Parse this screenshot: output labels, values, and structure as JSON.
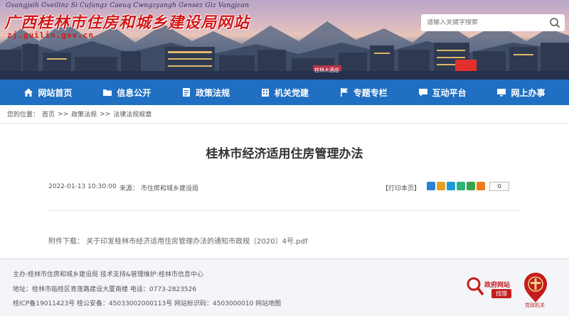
{
  "header": {
    "subtitle": "Gvangjsih Gveilinz Si Cufangz Caeuq Cwngzyangh Gensez Giz Vangjcan",
    "title": "广西桂林市住房和城乡建设局网站",
    "domain": "zj.guilin.gov.cn",
    "search_placeholder": "请输入关键字搜索",
    "hotel_sign": "桂林大酒店"
  },
  "nav": {
    "items": [
      {
        "label": "网站首页",
        "icon": "home-icon"
      },
      {
        "label": "信息公开",
        "icon": "folder-icon"
      },
      {
        "label": "政策法规",
        "icon": "document-icon"
      },
      {
        "label": "机关党建",
        "icon": "building-icon"
      },
      {
        "label": "专题专栏",
        "icon": "flag-icon"
      },
      {
        "label": "互动平台",
        "icon": "chat-icon"
      },
      {
        "label": "网上办事",
        "icon": "monitor-icon"
      }
    ]
  },
  "breadcrumb": {
    "prefix": "您的位置：",
    "items": [
      "首页",
      ">>",
      "政策法规",
      ">>",
      "法律法规规章"
    ]
  },
  "article": {
    "title": "桂林市经济适用住房管理办法",
    "date": "2022-01-13 10:30:00",
    "source_label": "来源：",
    "source": "市住房和城乡建设局",
    "print_label": "【打印本页】",
    "share_count": "0",
    "attachment_label": "附件下载：",
    "attachment_name": "关于印发桂林市经济适用住房管理办法的通知市政规〔2020〕4号.pdf"
  },
  "footer": {
    "line1": "主办:桂林市住房和城乡建设局 技术支持&管理维护:桂林市信息中心",
    "line2": "地址：桂林市临桂区青莲路建设大厦南楼 电话：0773-2823526",
    "line3": "桂ICP备19011423号  桂公安备：45033002000113号  网站标识码：4503000010    网站地图",
    "gov_badge_title": "政府网站",
    "gov_badge_button": "找错",
    "party_badge_text": "党政机关"
  },
  "colors": {
    "nav_bg": "#1f6fc2",
    "title_red": "#d31818",
    "share_icons": [
      "#2b7fd4",
      "#e0a020",
      "#1b9ad8",
      "#2bb37a",
      "#3aa24a",
      "#ee7a1a"
    ]
  }
}
